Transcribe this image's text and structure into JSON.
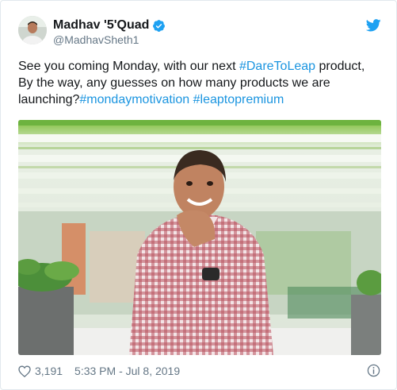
{
  "user": {
    "display_name": "Madhav '5'Quad",
    "handle": "@MadhavSheth1",
    "verified_icon": "verified-badge-icon",
    "avatar_icon": "avatar-photo"
  },
  "brand": {
    "icon": "twitter-bird-icon",
    "color": "#1da1f2"
  },
  "tweet": {
    "line1_text": "See you coming Monday, with our next ",
    "line1_hashtag": "#DareToLeap",
    "line1_tail": " product,",
    "line2_text": "By the way, any guesses on how many products we are",
    "line3_text": "launching?",
    "line3_hashtag1": "#mondaymotivation",
    "line3_space": " ",
    "line3_hashtag2": "#leaptopremium",
    "hashtag_color": "#1b95e0"
  },
  "media": {
    "image_icon": "tweet-photo"
  },
  "footer": {
    "like_icon": "heart-icon",
    "likes": "3,191",
    "timestamp": "5:33 PM - Jul 8, 2019",
    "info_icon": "info-icon"
  }
}
